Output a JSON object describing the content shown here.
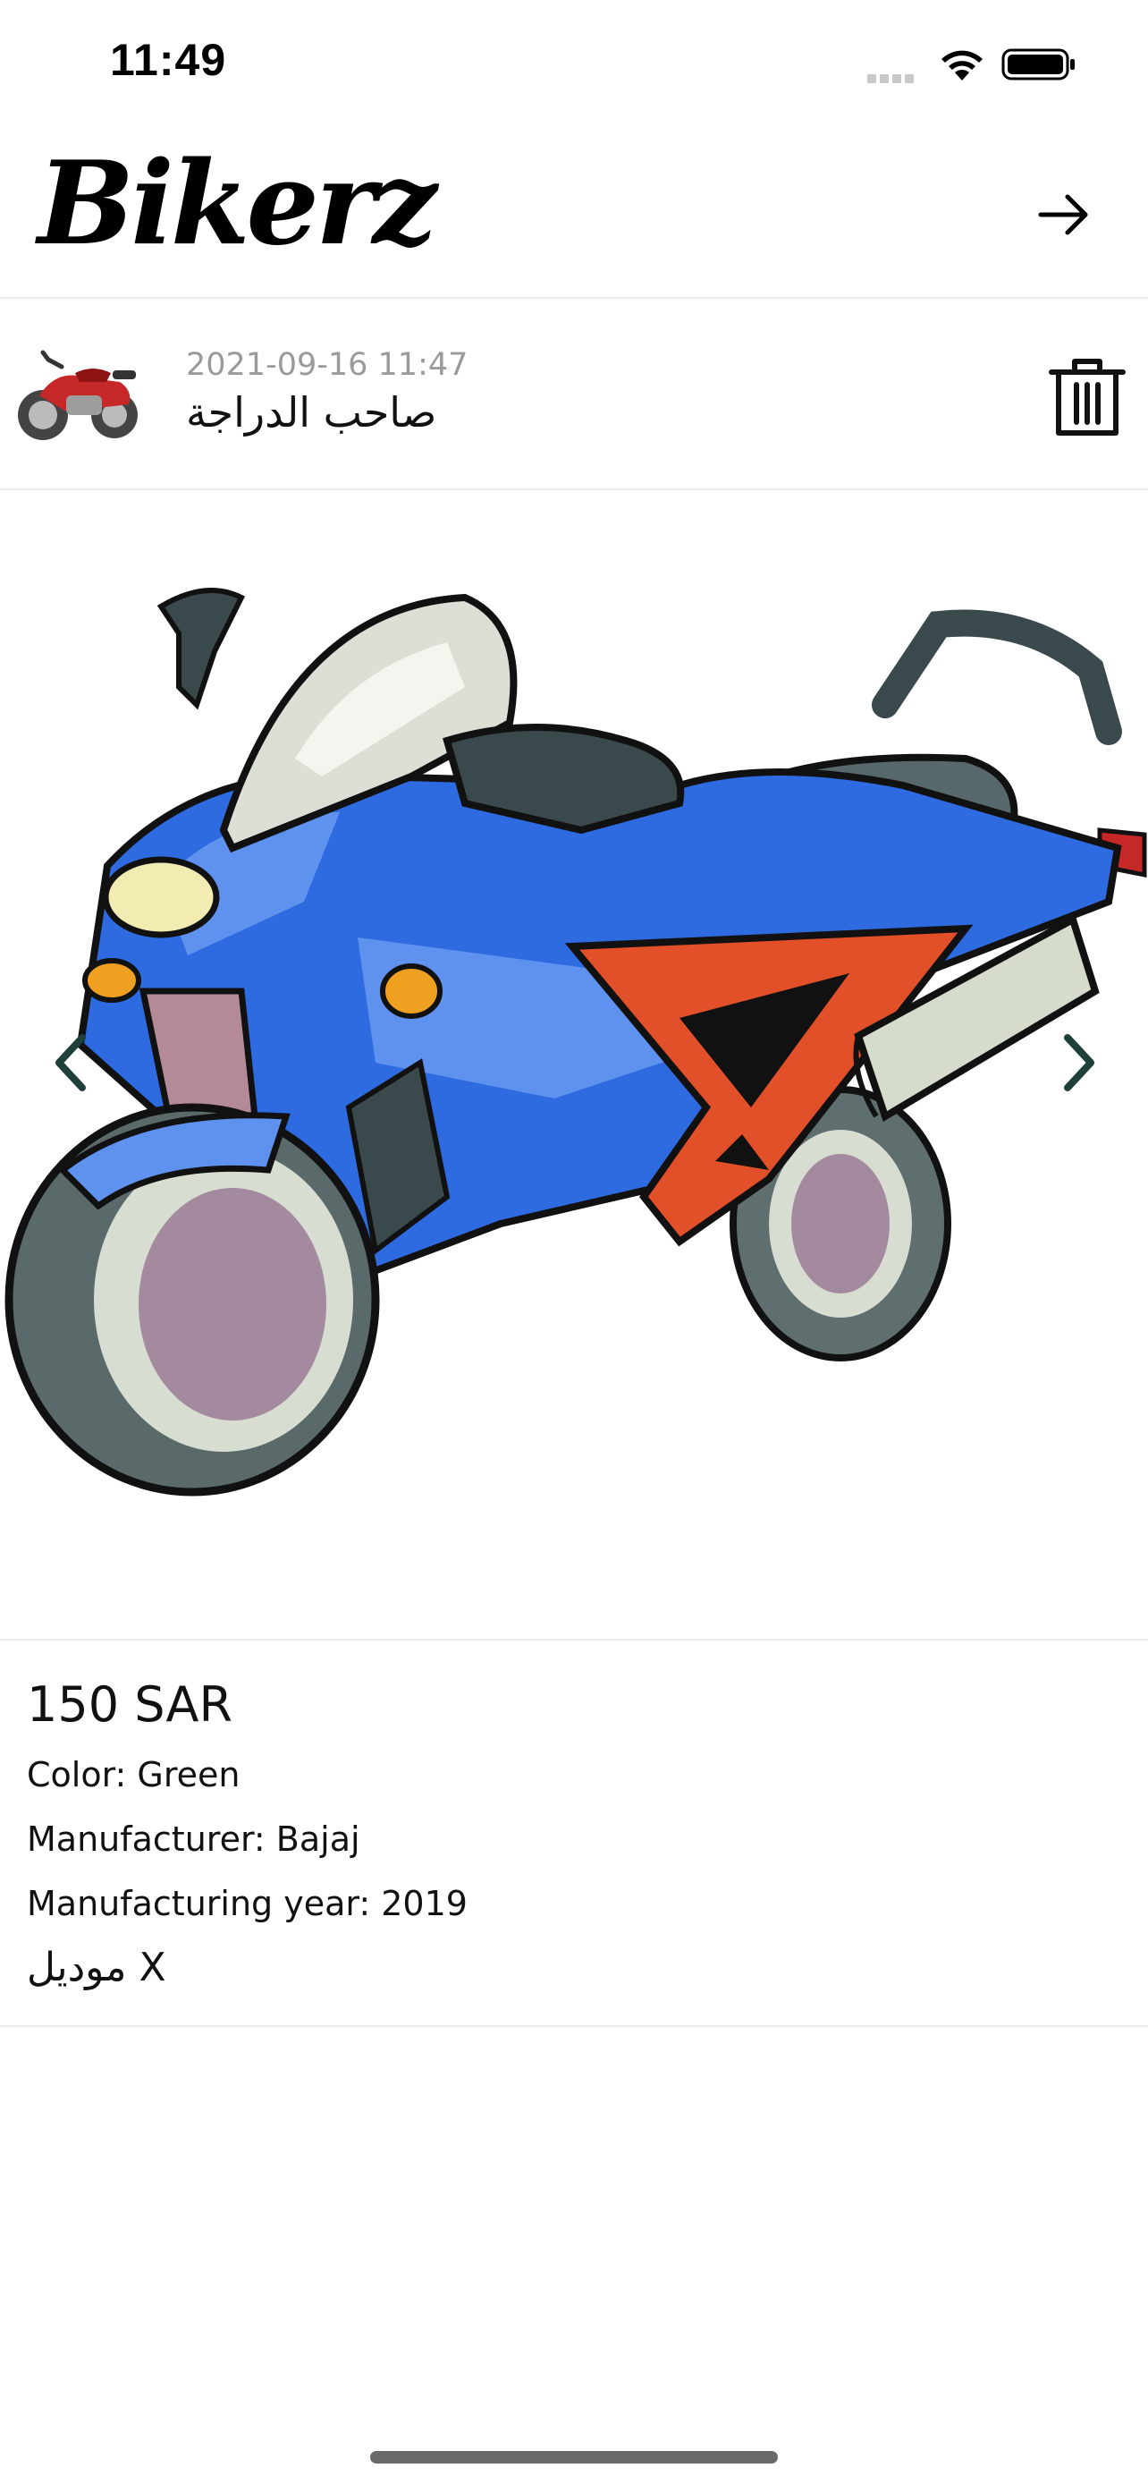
{
  "status_bar": {
    "time": "11:49"
  },
  "header": {
    "app_name": "Bikerz"
  },
  "post": {
    "date": "2021-09-16 11:47",
    "owner_label": "صاحب الدراجة"
  },
  "listing": {
    "price": "150 SAR",
    "color": "Color: Green",
    "manufacturer": "Manufacturer: Bajaj",
    "year": "Manufacturing year: 2019",
    "model": "موديل X"
  },
  "colors": {
    "accent": "#1f3f3a",
    "divider": "#ececec",
    "date_gray": "#9a9a9a"
  }
}
